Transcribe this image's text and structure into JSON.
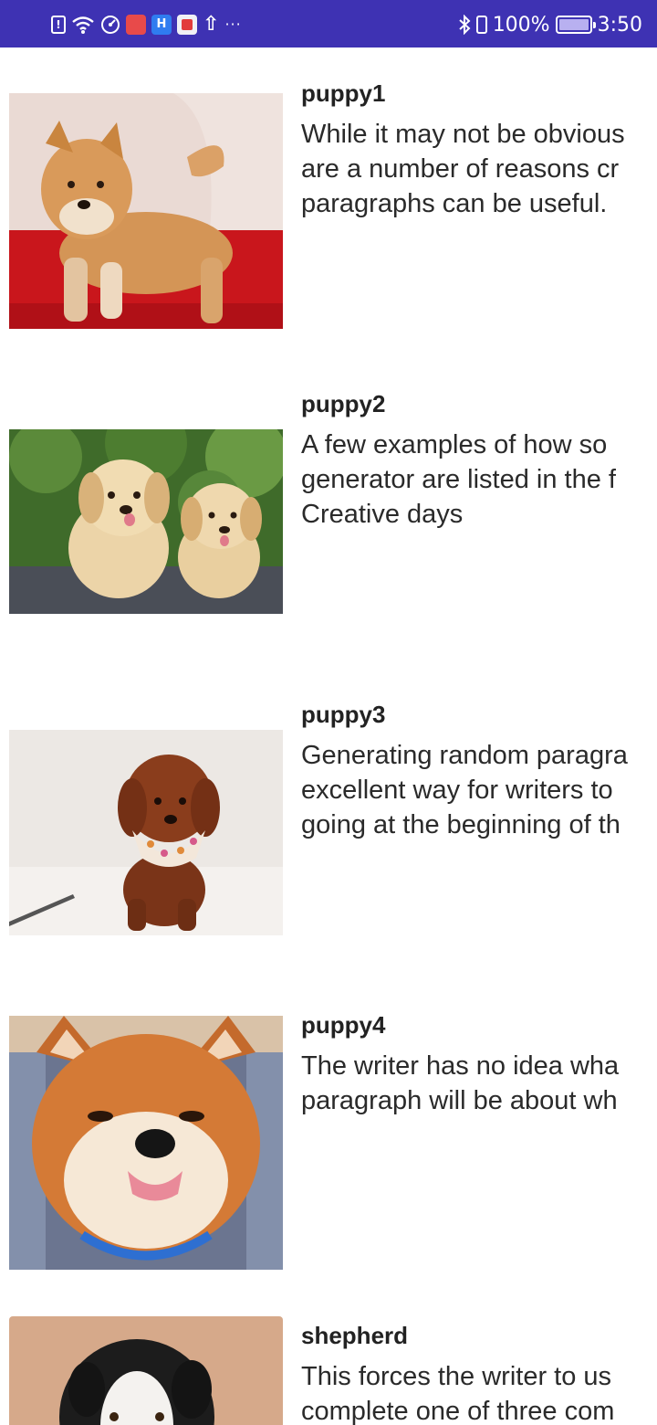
{
  "status_bar": {
    "battery_percent": "100%",
    "time": "3:50",
    "left_icons": [
      "sim-alert-icon",
      "wifi-icon",
      "hotspot-icon",
      "huawei-app-icon",
      "h-app-icon",
      "book-app-icon",
      "upload-icon",
      "more-icon"
    ],
    "right_icons": [
      "bluetooth-icon",
      "vibrate-icon",
      "battery-icon"
    ],
    "background_color": "#3e32b3"
  },
  "items": [
    {
      "title": "puppy1",
      "description": "While it may not be obvious\nare a number of reasons cr\nparagraphs can be useful.",
      "image": "shiba-puppy-on-red-cushion"
    },
    {
      "title": "puppy2",
      "description": "A few examples of how so\ngenerator are listed in the f\nCreative days",
      "image": "two-golden-retriever-puppies"
    },
    {
      "title": "puppy3",
      "description": "Generating random paragra\nexcellent way for writers to\ngoing at the beginning of th",
      "image": "brown-poodle-puppy-with-bandana"
    },
    {
      "title": "puppy4",
      "description": "The writer has no idea wha\nparagraph will be about wh",
      "image": "shiba-dog-face-tongue-out"
    },
    {
      "title": "shepherd",
      "description": "This forces the writer to us\ncomplete one of three com",
      "image": "black-white-shepherd-puppy"
    }
  ]
}
